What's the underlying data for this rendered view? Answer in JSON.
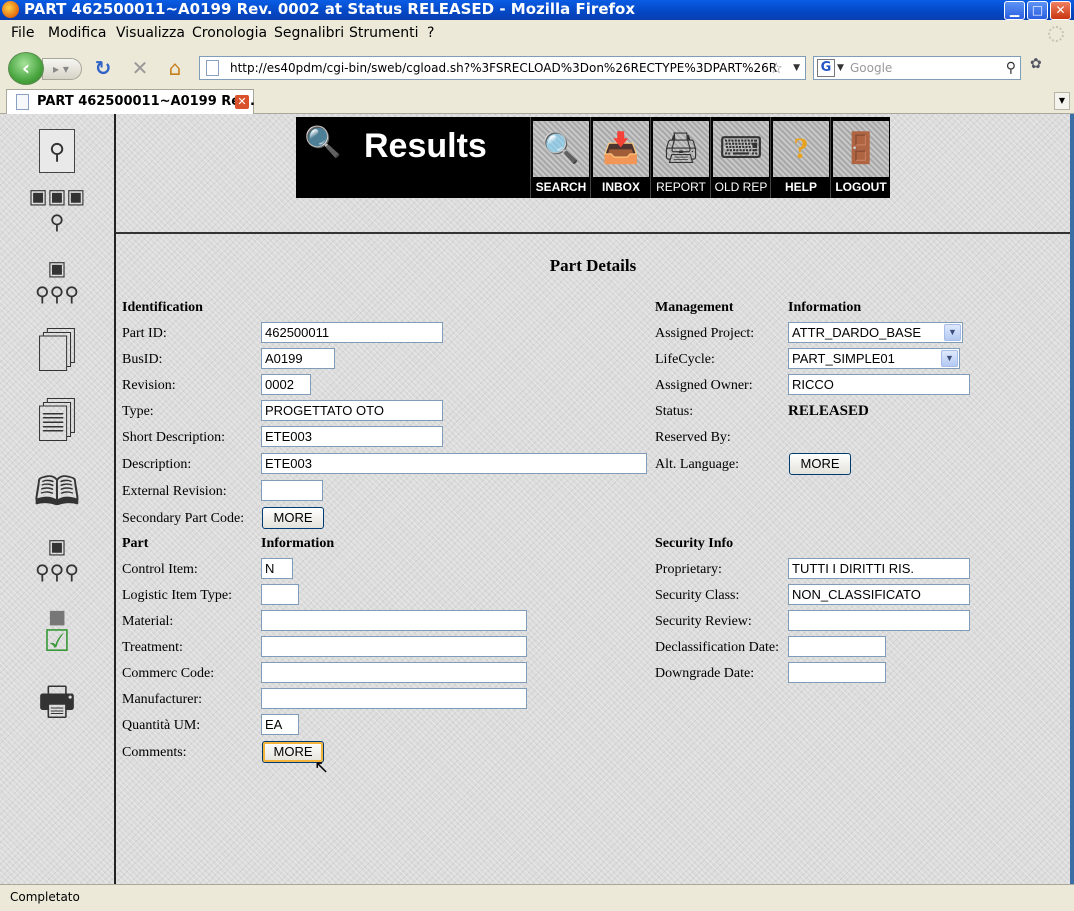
{
  "window": {
    "title": "PART 462500011~A0199 Rev. 0002 at Status RELEASED - Mozilla Firefox",
    "min": "▁",
    "max": "□",
    "close": "✕"
  },
  "menu": [
    "File",
    "Modifica",
    "Visualizza",
    "Cronologia",
    "Segnalibri",
    "Strumenti",
    "?"
  ],
  "nav": {
    "url": "http://es40pdm/cgi-bin/sweb/cgload.sh?%3FSRECLOAD%3Don%26RECTYPE%3DPART%26R",
    "search_placeholder": "Google"
  },
  "tab": {
    "label": "PART 462500011~A0199 Re..."
  },
  "status": "Completato",
  "header": {
    "logo": "Results",
    "buttons": [
      "SEARCH",
      "INBOX",
      "REPORT",
      "OLD REP",
      "HELP",
      "LOGOUT"
    ]
  },
  "page": {
    "title": "Part Details",
    "identification": {
      "heading": "Identification",
      "part_id_label": "Part ID:",
      "part_id": "462500011",
      "busid_label": "BusID:",
      "busid": "A0199",
      "revision_label": "Revision:",
      "revision": "0002",
      "type_label": "Type:",
      "type": "PROGETTATO OTO",
      "short_desc_label": "Short Description:",
      "short_desc": "ETE003",
      "desc_label": "Description:",
      "desc": "ETE003",
      "ext_rev_label": "External Revision:",
      "ext_rev": "",
      "sec_code_label": "Secondary Part Code:",
      "sec_code_button": "MORE"
    },
    "management": {
      "heading1": "Management",
      "heading2": "Information",
      "project_label": "Assigned Project:",
      "project": "ATTR_DARDO_BASE",
      "lifecycle_label": "LifeCycle:",
      "lifecycle": "PART_SIMPLE01",
      "owner_label": "Assigned Owner:",
      "owner": "RICCO",
      "status_label": "Status:",
      "status": "RELEASED",
      "reserved_label": "Reserved By:",
      "alt_lang_label": "Alt. Language:",
      "alt_lang_button": "MORE"
    },
    "part_info": {
      "heading1": "Part",
      "heading2": "Information",
      "control_label": "Control Item:",
      "control": "N",
      "logistic_label": "Logistic Item Type:",
      "logistic": "",
      "material_label": "Material:",
      "material": "",
      "treatment_label": "Treatment:",
      "treatment": "",
      "commerc_label": "Commerc Code:",
      "commerc": "",
      "manufacturer_label": "Manufacturer:",
      "manufacturer": "",
      "um_label": "Quantità UM:",
      "um": "EA",
      "comments_label": "Comments:",
      "comments_button": "MORE"
    },
    "security": {
      "heading": "Security Info",
      "proprietary_label": "Proprietary:",
      "proprietary": "TUTTI I DIRITTI RIS.",
      "class_label": "Security Class:",
      "class": "NON_CLASSIFICATO",
      "review_label": "Security Review:",
      "review": "",
      "declass_label": "Declassification Date:",
      "declass": "",
      "downgrade_label": "Downgrade Date:",
      "downgrade": ""
    }
  }
}
